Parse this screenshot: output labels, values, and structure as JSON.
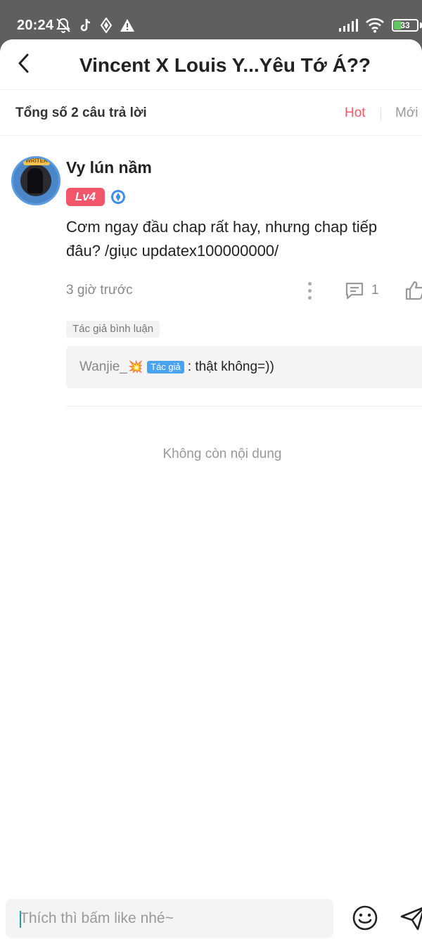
{
  "status_bar": {
    "time": "20:24",
    "battery": "33",
    "icons_left": [
      "bell-off-icon",
      "tiktok-icon",
      "app-icon",
      "warning-icon"
    ],
    "icons_right": [
      "signal-icon",
      "wifi-icon",
      "battery-icon"
    ]
  },
  "header": {
    "title": "Vincent X Louis Y...Yêu Tớ Á??"
  },
  "sort": {
    "total": "Tổng số 2 câu trả lời",
    "hot": "Hot",
    "new": "Mới",
    "active_color": "#f25a6a"
  },
  "comment": {
    "username": "Vy lún nầm",
    "avatar_badge": "WRITER",
    "level": "Lv4",
    "text": "Cơm ngay đầu chap rất hay, nhưng chap tiếp đâu? /giục updatex100000000/",
    "time": "3 giờ trước",
    "reply_count": "1",
    "author_tag": "Tác giả bình luận",
    "reply": {
      "user": "Wanjie_",
      "emoji": "💥",
      "author_badge": "Tác giả",
      "text": ": thật không=))"
    }
  },
  "end_text": "Không còn nội dung",
  "input": {
    "placeholder": "Thích thì bấm like nhé~"
  }
}
